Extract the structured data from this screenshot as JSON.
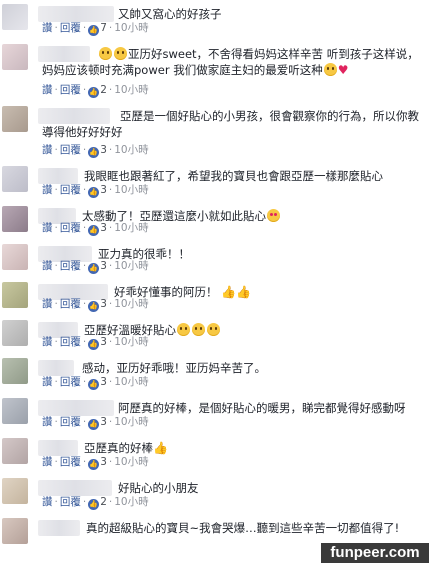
{
  "actions": {
    "like": "讚",
    "sep": "·",
    "reply": "回覆"
  },
  "comments": [
    {
      "text": "又帥又窩心的好孩子",
      "likes": "7",
      "time": "10小時"
    },
    {
      "text": "亚历好sweet，不舍得看妈妈这样辛苦  听到孩子这样说，妈妈应该顿时充满power  我们做家庭主妇的最爱听这种",
      "likes": "2",
      "time": "10小時"
    },
    {
      "text": "亞歷是一個好貼心的小男孩，很會觀察你的行為，所以你教導得他好好好好",
      "likes": "3",
      "time": "10小時"
    },
    {
      "text": "我眼眶也跟著紅了，希望我的寶貝也會跟亞歷一樣那麼貼心",
      "likes": "3",
      "time": "10小時"
    },
    {
      "text": "太感動了！亞歷還這麼小就如此貼心",
      "likes": "3",
      "time": "10小時"
    },
    {
      "text": "亚力真的很乖！！",
      "likes": "3",
      "time": "10小時"
    },
    {
      "text": "好乖好懂事的阿历！",
      "likes": "3",
      "time": "10小時"
    },
    {
      "text": "亞歷好溫暖好貼心",
      "likes": "3",
      "time": "10小時"
    },
    {
      "text": "感动，亚历好乖哦！亚历妈辛苦了。",
      "likes": "3",
      "time": "10小時"
    },
    {
      "text": "阿歷真的好棒，是個好貼心的暖男，睇完都覺得好感動呀",
      "likes": "3",
      "time": "10小時"
    },
    {
      "text": "亞歷真的好棒",
      "likes": "3",
      "time": "10小時"
    },
    {
      "text": "好貼心的小朋友",
      "likes": "2",
      "time": "10小時"
    },
    {
      "text": "真的超級貼心的寶貝~我會哭爆…聽到這些辛苦一切都值得了!",
      "likes": "",
      "time": ""
    }
  ],
  "watermark": "funpeer.com",
  "colors": {
    "link": "#365899",
    "meta": "#90949c",
    "like_badge": "#4267b2"
  }
}
